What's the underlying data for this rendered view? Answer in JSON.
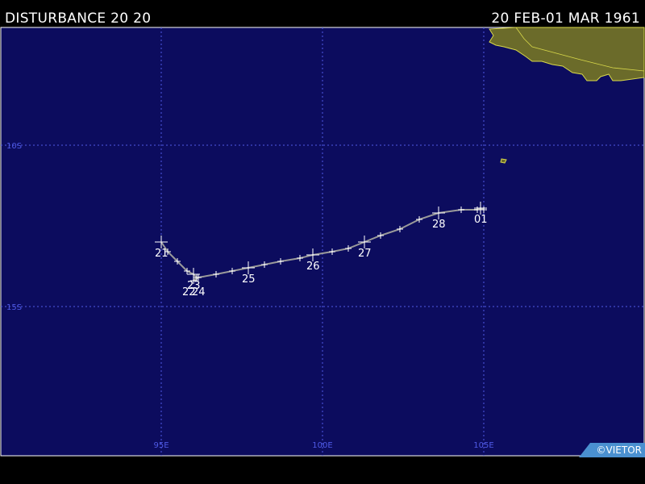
{
  "header": {
    "storm_name": "DISTURBANCE 20 20",
    "date_range": "20 FEB-01 MAR 1961"
  },
  "credit": "©VIETOR",
  "colors": {
    "ocean": "#0c0c5e",
    "grid": "#4f5ae6",
    "land": "#6b6b2a",
    "coast": "#d8d84a",
    "track": "#9a9a9a",
    "marker": "#ffffff",
    "label": "#ffffff"
  },
  "chart_data": {
    "type": "map-track",
    "lat_labels": [
      {
        "lat": -10,
        "label": "10S"
      },
      {
        "lat": -15,
        "label": "15S"
      }
    ],
    "lon_labels": [
      {
        "lon": 95,
        "label": "95E"
      },
      {
        "lon": 100,
        "label": "100E"
      },
      {
        "lon": 105,
        "label": "105E"
      }
    ],
    "track": [
      {
        "lon": 95.0,
        "lat": -13.0,
        "day": "21"
      },
      {
        "lon": 95.2,
        "lat": -13.3
      },
      {
        "lon": 95.5,
        "lat": -13.6
      },
      {
        "lon": 95.8,
        "lat": -13.9
      },
      {
        "lon": 96.0,
        "lat": -14.0,
        "day": "23"
      },
      {
        "lon": 96.1,
        "lat": -14.1
      },
      {
        "lon": 96.0,
        "lat": -14.2
      },
      {
        "lon": 96.15,
        "lat": -14.1
      },
      {
        "lon": 96.7,
        "lat": -14.0
      },
      {
        "lon": 97.2,
        "lat": -13.9
      },
      {
        "lon": 97.7,
        "lat": -13.8,
        "day": "25"
      },
      {
        "lon": 98.2,
        "lat": -13.7
      },
      {
        "lon": 98.7,
        "lat": -13.6
      },
      {
        "lon": 99.3,
        "lat": -13.5
      },
      {
        "lon": 99.7,
        "lat": -13.4,
        "day": "26"
      },
      {
        "lon": 100.3,
        "lat": -13.3
      },
      {
        "lon": 100.8,
        "lat": -13.2
      },
      {
        "lon": 101.3,
        "lat": -13.0,
        "day": "27"
      },
      {
        "lon": 101.8,
        "lat": -12.8
      },
      {
        "lon": 102.4,
        "lat": -12.6
      },
      {
        "lon": 103.0,
        "lat": -12.3
      },
      {
        "lon": 103.6,
        "lat": -12.1,
        "day": "28"
      },
      {
        "lon": 104.3,
        "lat": -12.0
      },
      {
        "lon": 104.8,
        "lat": -12.0
      },
      {
        "lon": 104.9,
        "lat": -11.95,
        "day": "01"
      },
      {
        "lon": 105.0,
        "lat": -12.0
      }
    ],
    "extra_day_labels": [
      {
        "lon": 95.85,
        "lat": -14.2,
        "day": "22"
      },
      {
        "lon": 96.15,
        "lat": -14.2,
        "day": "24"
      }
    ]
  }
}
